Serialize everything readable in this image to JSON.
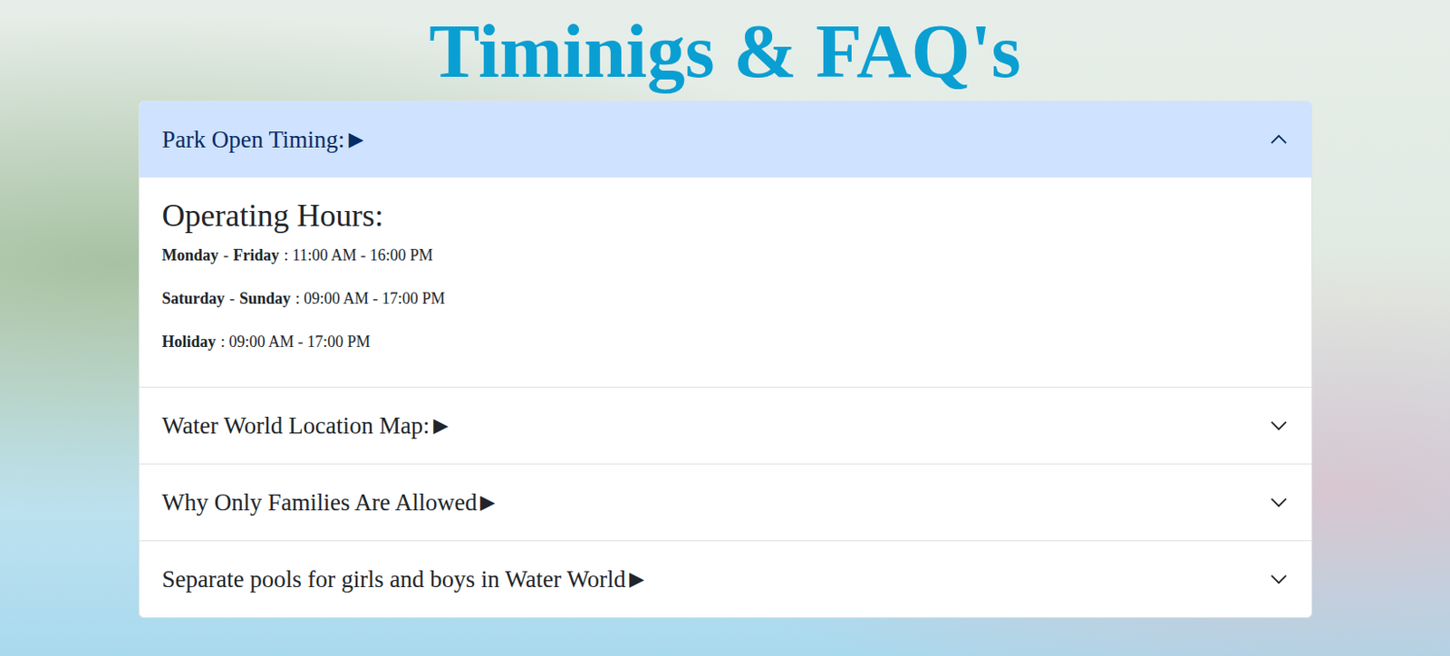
{
  "title": "Timinigs & FAQ's",
  "accordion": [
    {
      "title": "Park Open Timing:",
      "arrow": "▶",
      "expanded": true,
      "content": {
        "heading": "Operating Hours:",
        "rows": [
          [
            {
              "text": "Monday",
              "kind": "bold"
            },
            {
              "text": "-",
              "kind": "plain"
            },
            {
              "text": "Friday",
              "kind": "bold"
            },
            {
              "text": ": 11:00 AM - 16:00 PM",
              "kind": "plain"
            }
          ],
          [
            {
              "text": "Saturday",
              "kind": "bold"
            },
            {
              "text": "-",
              "kind": "plain"
            },
            {
              "text": "Sunday",
              "kind": "bold"
            },
            {
              "text": ": 09:00 AM - 17:00 PM",
              "kind": "plain"
            }
          ],
          [
            {
              "text": "Holiday",
              "kind": "bold"
            },
            {
              "text": ": 09:00 AM - 17:00 PM",
              "kind": "plain"
            }
          ]
        ]
      }
    },
    {
      "title": "Water World Location Map:",
      "arrow": "▶",
      "expanded": false
    },
    {
      "title": "Why Only Families Are Allowed",
      "arrow": "▶",
      "expanded": false
    },
    {
      "title": "Separate pools for girls and boys in Water World",
      "arrow": "▶",
      "expanded": false
    }
  ]
}
